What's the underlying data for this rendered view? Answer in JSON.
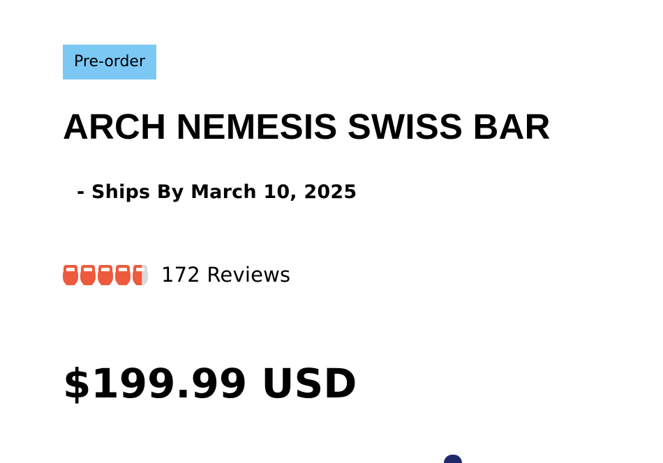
{
  "product": {
    "badge": "Pre-order",
    "title": "ARCH NEMESIS SWISS BAR",
    "ship_note": "- Ships By March 10, 2025",
    "rating": {
      "value": 4.6,
      "max": 5,
      "icon": "kettlebell-icon",
      "fill_color": "#ee5a3d",
      "empty_color": "#d9d9d9",
      "reviews_label": "172 Reviews"
    },
    "price": "$199.99 USD"
  },
  "colors": {
    "badge_bg": "#7cc8f4",
    "text": "#000000"
  }
}
